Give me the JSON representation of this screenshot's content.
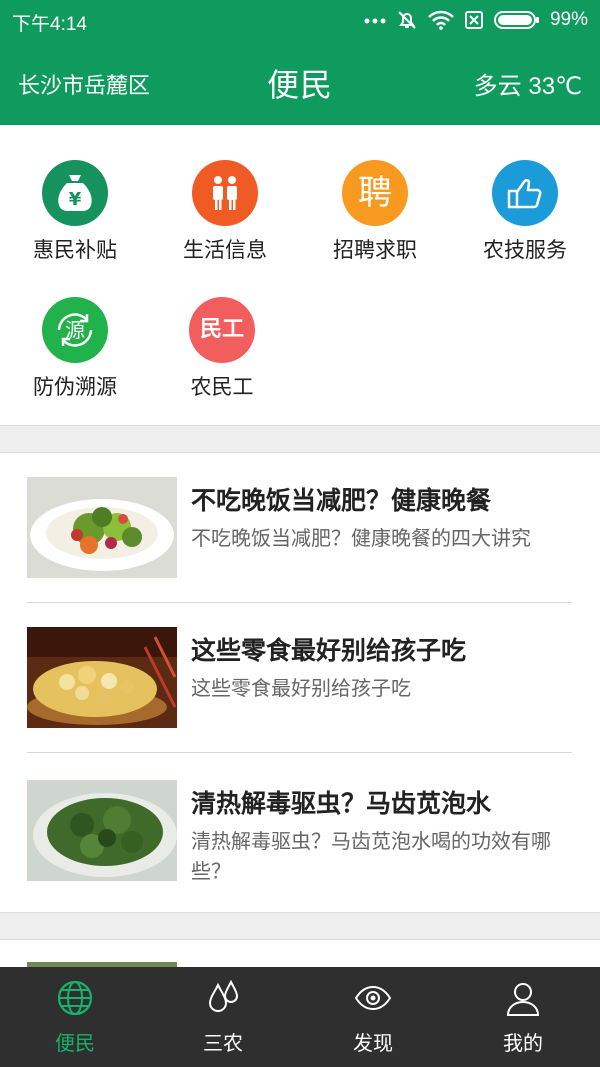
{
  "statusbar": {
    "time": "下午4:14",
    "battery": "99%"
  },
  "header": {
    "location": "长沙市岳麓区",
    "title": "便民",
    "weather_text": "多云",
    "temperature": "33℃"
  },
  "services": [
    {
      "label": "惠民补贴",
      "icon": "money-bag-icon",
      "color": "#16925e",
      "glyph": "¥"
    },
    {
      "label": "生活信息",
      "icon": "people-icon",
      "color": "#f05a24"
    },
    {
      "label": "招聘求职",
      "icon": "recruit-icon",
      "color": "#f79a1f",
      "glyph": "聘"
    },
    {
      "label": "农技服务",
      "icon": "thumbs-up-icon",
      "color": "#1b9bd8"
    },
    {
      "label": "防伪溯源",
      "icon": "trace-source-icon",
      "color": "#22b24c",
      "glyph": "源"
    },
    {
      "label": "农民工",
      "icon": "migrant-worker-icon",
      "color": "#f25e5e",
      "glyph": "民工"
    }
  ],
  "news": [
    {
      "title": "不吃晚饭当减肥？健康晚餐",
      "summary": "不吃晚饭当减肥？健康晚餐的四大讲究",
      "thumb": "salad-image"
    },
    {
      "title": "这些零食最好别给孩子吃",
      "summary": "这些零食最好别给孩子吃",
      "thumb": "popcorn-image"
    },
    {
      "title": "清热解毒驱虫？马齿苋泡水",
      "summary": "清热解毒驱虫？马齿苋泡水喝的功效有哪些？",
      "thumb": "purslane-image"
    }
  ],
  "tabs": [
    {
      "label": "便民",
      "icon": "globe-icon",
      "active": true
    },
    {
      "label": "三农",
      "icon": "droplets-icon",
      "active": false
    },
    {
      "label": "发现",
      "icon": "eye-icon",
      "active": false
    },
    {
      "label": "我的",
      "icon": "user-icon",
      "active": false
    }
  ],
  "colors": {
    "brand": "#0f9a5e",
    "tab_active": "#16b36a",
    "tabbar_bg": "#2f2f2f"
  }
}
